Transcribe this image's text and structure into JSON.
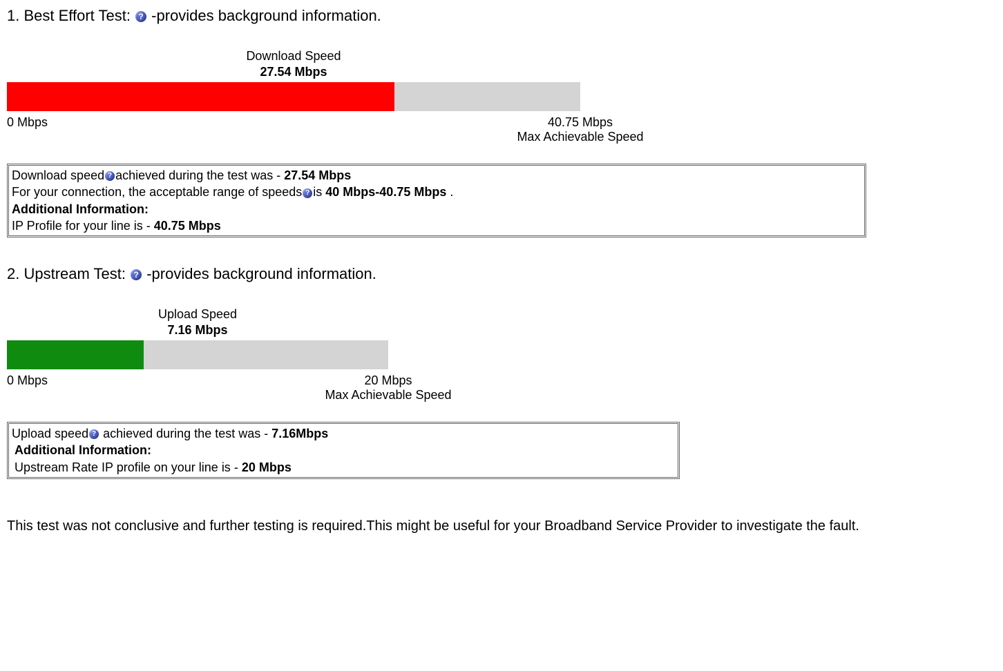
{
  "section1": {
    "title_prefix": "1. Best Effort Test: ",
    "title_suffix": " -provides background information.",
    "gauge": {
      "label": "Download Speed",
      "value_display": "27.54 Mbps",
      "min_label": "0 Mbps",
      "max_label": "40.75 Mbps",
      "max_sublabel": "Max Achievable Speed",
      "value": 27.54,
      "max": 40.75,
      "color": "red"
    },
    "info": {
      "line1_a": "Download speed",
      "line1_b": "achieved during the test was - ",
      "line1_bold": "27.54 Mbps",
      "line2_a": "For your connection, the acceptable range of speeds",
      "line2_b": "is ",
      "line2_bold": "40 Mbps-40.75 Mbps",
      "line2_end": " .",
      "additional_label": "Additional Information:",
      "line3_a": "IP Profile for your line is - ",
      "line3_bold": "40.75 Mbps"
    }
  },
  "section2": {
    "title_prefix": "2. Upstream Test: ",
    "title_suffix": " -provides background information.",
    "gauge": {
      "label": "Upload Speed",
      "value_display": "7.16 Mbps",
      "min_label": "0 Mbps",
      "max_label": "20 Mbps",
      "max_sublabel": "Max Achievable Speed",
      "value": 7.16,
      "max": 20,
      "color": "green"
    },
    "info": {
      "line1_a": "Upload speed",
      "line1_b": " achieved during the test was - ",
      "line1_bold": "7.16Mbps",
      "additional_label": "Additional Information:",
      "line3_a": "Upstream Rate IP profile on your line is - ",
      "line3_bold": "20 Mbps"
    }
  },
  "footer": "This test was not conclusive and further testing is required.This might be useful for your Broadband Service Provider to investigate the fault.",
  "chart_data": [
    {
      "type": "bar",
      "title": "Download Speed",
      "categories": [
        "Download Speed"
      ],
      "values": [
        27.54
      ],
      "unit": "Mbps",
      "xlim": [
        0,
        40.75
      ],
      "color": "#ff0000",
      "ip_profile": 40.75,
      "acceptable_range": [
        40,
        40.75
      ]
    },
    {
      "type": "bar",
      "title": "Upload Speed",
      "categories": [
        "Upload Speed"
      ],
      "values": [
        7.16
      ],
      "unit": "Mbps",
      "xlim": [
        0,
        20
      ],
      "color": "#0f8b0f",
      "ip_profile": 20
    }
  ]
}
